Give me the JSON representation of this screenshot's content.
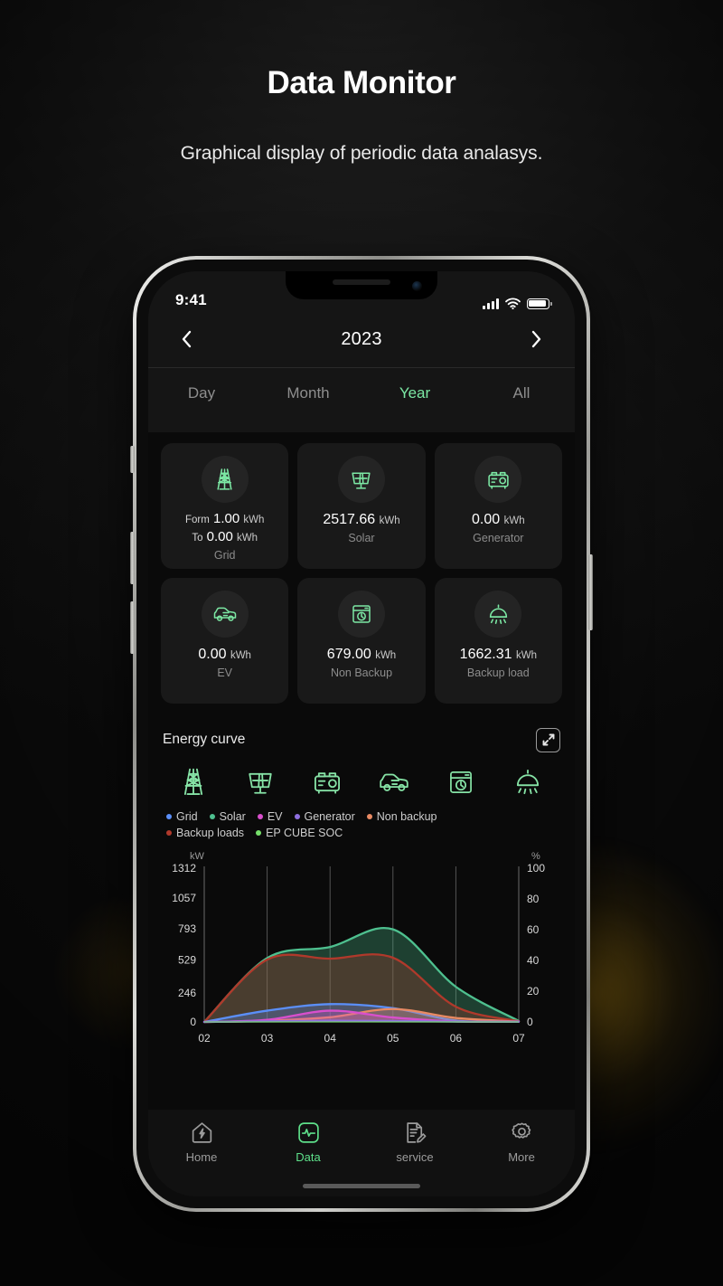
{
  "header": {
    "title": "Data Monitor",
    "subtitle": "Graphical display of periodic data analasys."
  },
  "statusbar": {
    "time": "9:41",
    "signal_icon": "cellular-bars-icon",
    "wifi_icon": "wifi-icon",
    "battery_icon": "battery-icon"
  },
  "datenav": {
    "prev_icon": "chevron-left-icon",
    "next_icon": "chevron-right-icon",
    "label": "2023"
  },
  "period_tabs": [
    {
      "label": "Day",
      "active": false
    },
    {
      "label": "Month",
      "active": false
    },
    {
      "label": "Year",
      "active": true
    },
    {
      "label": "All",
      "active": false
    }
  ],
  "stat_cards": [
    {
      "icon": "transmission-tower-icon",
      "label": "Grid",
      "from_prefix": "Form",
      "from_value": "1.00",
      "from_unit": "kWh",
      "to_prefix": "To",
      "to_value": "0.00",
      "to_unit": "kWh"
    },
    {
      "icon": "solar-panel-icon",
      "label": "Solar",
      "value": "2517.66",
      "unit": "kWh"
    },
    {
      "icon": "generator-icon",
      "label": "Generator",
      "value": "0.00",
      "unit": "kWh"
    },
    {
      "icon": "ev-car-icon",
      "label": "EV",
      "value": "0.00",
      "unit": "kWh"
    },
    {
      "icon": "washing-machine-icon",
      "label": "Non Backup",
      "value": "679.00",
      "unit": "kWh"
    },
    {
      "icon": "ceiling-lamp-icon",
      "label": "Backup load",
      "value": "1662.31",
      "unit": "kWh"
    }
  ],
  "energy_curve": {
    "title": "Energy curve",
    "expand_icon": "expand-arrows-icon",
    "source_icons": [
      "transmission-tower-icon",
      "solar-panel-icon",
      "generator-icon",
      "ev-car-icon",
      "washing-machine-icon",
      "ceiling-lamp-icon"
    ]
  },
  "chart_data": {
    "type": "area",
    "title": "Energy curve",
    "xlabel": "",
    "ylabel": "kW",
    "y2label": "%",
    "ylim": [
      0,
      1312
    ],
    "y2lim": [
      0,
      100
    ],
    "yticks": [
      0,
      246,
      529,
      793,
      1057,
      1312
    ],
    "y2ticks": [
      0,
      20,
      40,
      60,
      80,
      100
    ],
    "x": [
      "02",
      "03",
      "04",
      "05",
      "06",
      "07"
    ],
    "xticklabels": [
      "02",
      "03",
      "04",
      "05",
      "06",
      "07"
    ],
    "grid": "vertical",
    "legend_position": "above-plot",
    "series": [
      {
        "name": "Grid",
        "color": "#5b8ff9",
        "axis": "left",
        "values": [
          0,
          96,
          152,
          118,
          12,
          4
        ]
      },
      {
        "name": "Solar",
        "color": "#4ec08f",
        "axis": "left",
        "values": [
          0,
          545,
          640,
          790,
          300,
          8
        ]
      },
      {
        "name": "EV",
        "color": "#d94fcd",
        "axis": "left",
        "values": [
          0,
          18,
          96,
          38,
          4,
          2
        ]
      },
      {
        "name": "Generator",
        "color": "#8e6fe0",
        "axis": "left",
        "values": [
          0,
          6,
          10,
          8,
          3,
          1
        ]
      },
      {
        "name": "Non backup",
        "color": "#e98a63",
        "axis": "left",
        "values": [
          0,
          10,
          40,
          110,
          34,
          3
        ]
      },
      {
        "name": "Backup loads",
        "color": "#b0392b",
        "axis": "left",
        "values": [
          0,
          532,
          540,
          548,
          130,
          6
        ]
      },
      {
        "name": "EP CUBE SOC",
        "color": "#76e06a",
        "axis": "right",
        "values": [
          0,
          0,
          0,
          0,
          0,
          0
        ]
      }
    ]
  },
  "bottom_nav": [
    {
      "icon": "home-bolt-icon",
      "label": "Home",
      "active": false
    },
    {
      "icon": "pulse-data-icon",
      "label": "Data",
      "active": true
    },
    {
      "icon": "document-pencil-icon",
      "label": "service",
      "active": false
    },
    {
      "icon": "gear-icon",
      "label": "More",
      "active": false
    }
  ],
  "colors": {
    "accent_green": "#7ce8a4",
    "nav_active": "#5ee08a",
    "card_bg": "#191919",
    "screen_bg": "#0a0a0a"
  }
}
